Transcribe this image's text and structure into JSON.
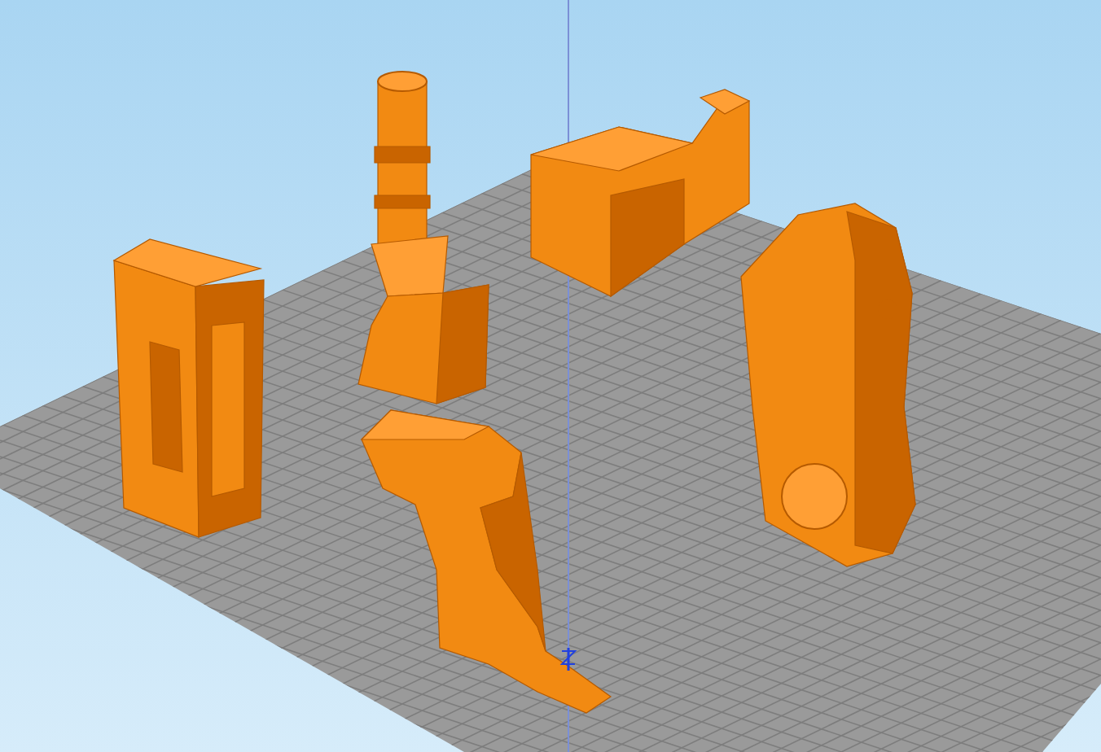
{
  "viewport": {
    "build_plate": {
      "grid": true
    },
    "parts": [
      {
        "kind": "pack"
      },
      {
        "kind": "nozzle"
      },
      {
        "kind": "hook"
      },
      {
        "kind": "body"
      },
      {
        "kind": "handle"
      }
    ]
  }
}
